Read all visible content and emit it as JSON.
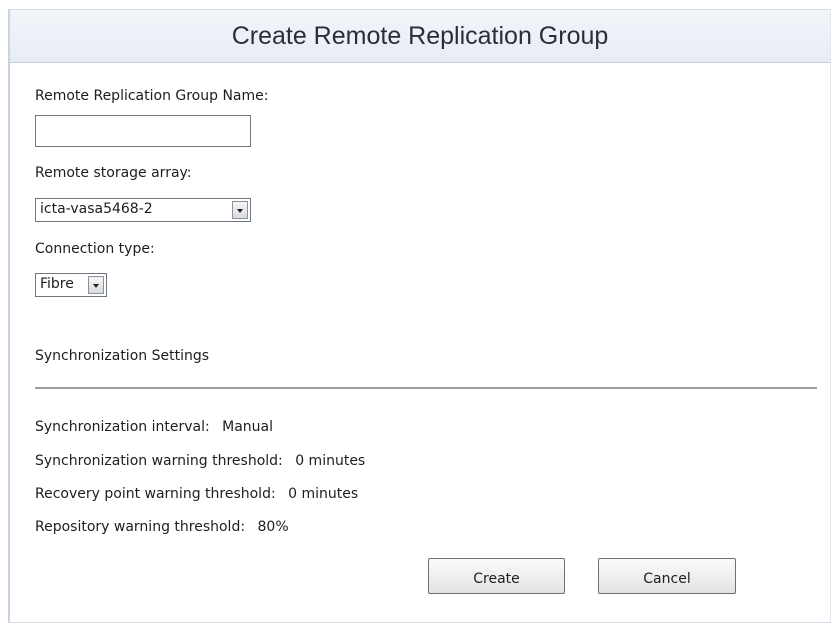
{
  "dialog": {
    "title": "Create Remote Replication Group"
  },
  "form": {
    "name_label": "Remote Replication Group Name:",
    "name_value": "",
    "array_label": "Remote storage array:",
    "array_selected": "icta-vasa5468-2",
    "connection_label": "Connection type:",
    "connection_selected": "Fibre"
  },
  "sync": {
    "heading": "Synchronization Settings",
    "interval_label": "Synchronization interval:",
    "interval_value": "Manual",
    "sync_warning_label": "Synchronization warning threshold:",
    "sync_warning_value": "0 minutes",
    "recovery_warning_label": "Recovery point warning threshold:",
    "recovery_warning_value": "0 minutes",
    "repository_warning_label": "Repository warning threshold:",
    "repository_warning_value": "80%"
  },
  "buttons": {
    "create": "Create",
    "cancel": "Cancel"
  },
  "icons": {
    "dropdown": "chevron-down-icon"
  }
}
